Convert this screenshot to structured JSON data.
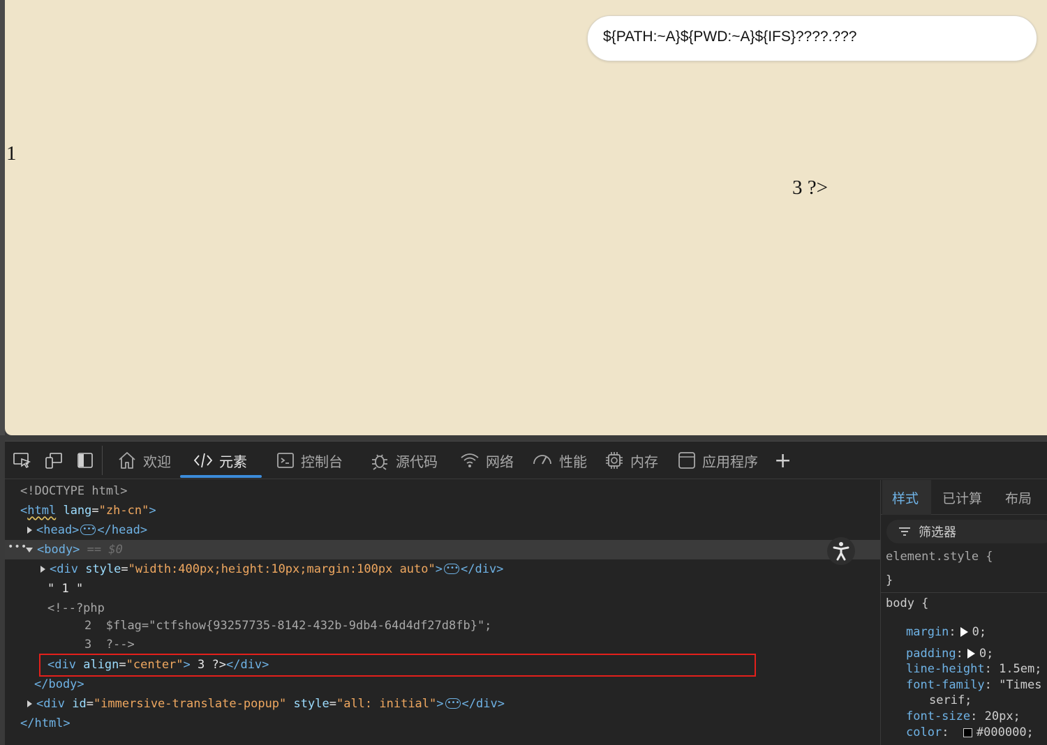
{
  "page": {
    "translate_text": "${PATH:~A}${PWD:~A}${IFS}????.???",
    "text_one": "1",
    "text_three": "3 ?>"
  },
  "devtools": {
    "tabs": [
      {
        "label": "欢迎",
        "icon": "home-icon"
      },
      {
        "label": "元素",
        "icon": "code-icon"
      },
      {
        "label": "控制台",
        "icon": "console-icon"
      },
      {
        "label": "源代码",
        "icon": "bug-icon"
      },
      {
        "label": "网络",
        "icon": "wifi-icon"
      },
      {
        "label": "性能",
        "icon": "gauge-icon"
      },
      {
        "label": "内存",
        "icon": "chip-icon"
      },
      {
        "label": "应用程序",
        "icon": "app-icon"
      }
    ],
    "active_tab": "元素",
    "add_tab_symbol": "+",
    "dom": {
      "doctype": "<!DOCTYPE html>",
      "html_open": "<",
      "html_tag": "html",
      "html_attr": "lang",
      "html_val": "\"zh-cn\"",
      "head_open": "<head>",
      "head_close": "</head>",
      "body_open": "<body>",
      "body_ref": "== $0",
      "div1_tag": "<div",
      "div1_attr": "style",
      "div1_val": "\"width:400px;height:10px;margin:100px auto\"",
      "div1_close": "</div>",
      "text_node": "\" 1 \"",
      "comment_open": "<!--?php",
      "flag_line_no": "2",
      "flag_line": "$flag=\"ctfshow{93257735-8142-432b-9db4-64d4df27d8fb}\";",
      "comment_line_no": "3",
      "comment_close": "?-->",
      "div2_tag": "<div",
      "div2_attr": "align",
      "div2_val": "\"center\"",
      "div2_text": "3 ?>",
      "div2_close": "</div>",
      "body_close": "</body>",
      "div3_tag": "<div",
      "div3_attr1": "id",
      "div3_val1": "\"immersive-translate-popup\"",
      "div3_attr2": "style",
      "div3_val2": "\"all: initial\"",
      "div3_close": "</div>",
      "html_close": "</html>"
    },
    "styles_pane": {
      "tabs": [
        "样式",
        "已计算",
        "布局"
      ],
      "filter_label": "筛选器",
      "element_style": "element.style {",
      "close_brace": "}",
      "body_selector": "body {",
      "rules": [
        {
          "prop": "margin",
          "value": "0;"
        },
        {
          "prop": "padding",
          "value": "0;"
        },
        {
          "prop": "line-height",
          "value": "1.5em;"
        },
        {
          "prop": "font-family",
          "value": "\"Times"
        },
        {
          "prop": "",
          "value": "serif;"
        },
        {
          "prop": "font-size",
          "value": "20px;"
        },
        {
          "prop": "color",
          "value": "#000000;"
        }
      ]
    }
  }
}
